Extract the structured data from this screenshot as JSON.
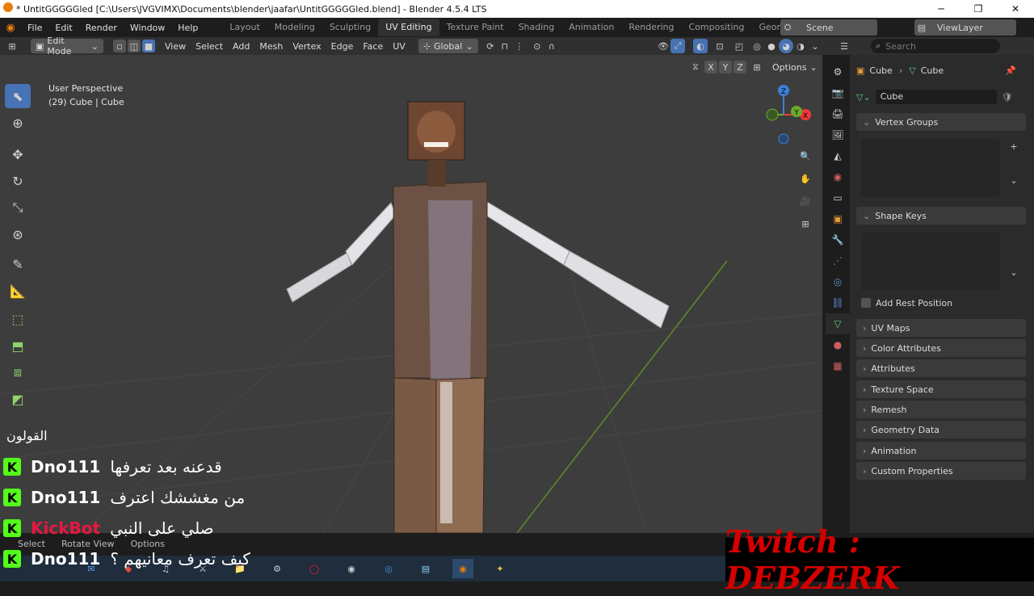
{
  "window": {
    "title": "* UntitGGGGGled [C:\\Users\\JVGVIMX\\Documents\\blender\\jaafar\\UntitGGGGGled.blend] - Blender 4.5.4 LTS"
  },
  "menu": [
    "File",
    "Edit",
    "Render",
    "Window",
    "Help"
  ],
  "workspaces": [
    "Layout",
    "Modeling",
    "Sculpting",
    "UV Editing",
    "Texture Paint",
    "Shading",
    "Animation",
    "Rendering",
    "Compositing",
    "Geometry Node"
  ],
  "active_workspace": "UV Editing",
  "scene_label": "Scene",
  "viewlayer_label": "ViewLayer",
  "header": {
    "mode": "Edit Mode",
    "menus": [
      "View",
      "Select",
      "Add",
      "Mesh",
      "Vertex",
      "Edge",
      "Face",
      "UV"
    ],
    "transform": "Global",
    "options": "Options",
    "axes": [
      "X",
      "Y",
      "Z"
    ]
  },
  "viewport": {
    "perspective": "User Perspective",
    "object": "(29) Cube | Cube"
  },
  "gizmo": {
    "x_label": "X",
    "y_label": "Y",
    "z_label": "Z",
    "x_color": "#f0393c",
    "y_color": "#6bab2c",
    "z_color": "#3e7fd8"
  },
  "properties": {
    "search_placeholder": "Search",
    "breadcrumb_object": "Cube",
    "breadcrumb_data": "Cube",
    "mesh_name": "Cube",
    "panels": {
      "vertex_groups": "Vertex Groups",
      "shape_keys": "Shape Keys",
      "add_rest_position": "Add Rest Position",
      "uv_maps": "UV Maps",
      "color_attributes": "Color Attributes",
      "attributes": "Attributes",
      "texture_space": "Texture Space",
      "remesh": "Remesh",
      "geometry_data": "Geometry Data",
      "animation": "Animation",
      "custom_properties": "Custom Properties"
    }
  },
  "status": {
    "select": "Select",
    "rotate_view": "Rotate View",
    "options": "Options"
  },
  "chat": {
    "partial_line_1": "القولون",
    "lines": [
      {
        "user": "Dno111",
        "message": "قدعنه بعد تعرفها",
        "user_color": "#ffffff"
      },
      {
        "user": "Dno111",
        "message": "من مغششك اعترف",
        "user_color": "#ffffff"
      },
      {
        "user": "KickBot",
        "message": "صلي على النبي",
        "user_color": "#e8173f"
      },
      {
        "user": "Dno111",
        "message": "كيف تعرف معانيهم ؟",
        "user_color": "#ffffff"
      }
    ],
    "badge_letter": "K"
  },
  "overlay": {
    "twitch_text": "Twitch : DEBZERK"
  }
}
